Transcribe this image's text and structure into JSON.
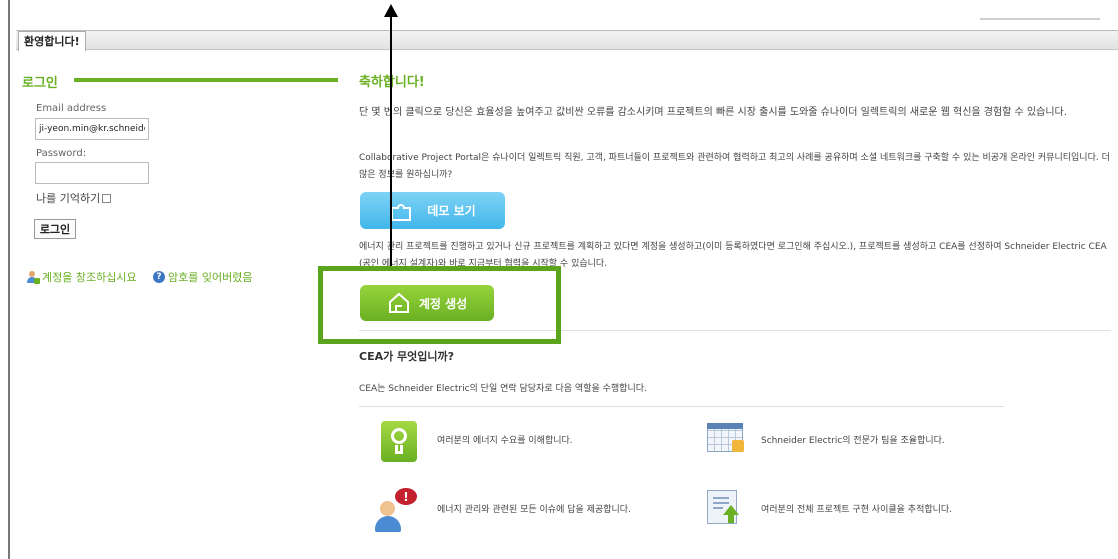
{
  "tab": {
    "label": "환영합니다!"
  },
  "login": {
    "heading": "로그인",
    "email_label": "Email address",
    "email_value": "ji-yeon.min@kr.schneider-",
    "password_label": "Password:",
    "password_value": "",
    "remember_label": "나를 기억하기",
    "login_button": "로그인",
    "create_account_link": "계정을 창조하십시요",
    "forgot_password_link": "암호를 잊어버렸음"
  },
  "main": {
    "title": "축하합니다!",
    "intro": "단 몇 번의 클릭으로 당신은 효율성을 높여주고 값비싼 오류를 감소시키며 프로젝트의 빠른 시장 출시를 도와줄 슈나이더 일렉트릭의 새로운 웹 혁신을 경험할 수 있습니다.",
    "portal_desc": "Collaborative Project Portal은 슈나이더 일렉트릭 직원, 고객, 파트너들이 프로젝트와 관련하여 협력하고 최고의 사례를 공유하며 소셜 네트워크를 구축할 수 있는 비공개 온라인 커뮤니티입니다. 더 많은 정보를 원하십니까?",
    "demo_button": "데모 보기",
    "energy_desc": "에너지 관리 프로젝트를 진행하고 있거나 신규 프로젝트를 계획하고 있다면 계정을 생성하고(이미 등록하였다면 로그인해 주십시오.), 프로젝트를 생성하고 CEA를 선정하여 Schneider Electric CEA (공인 에너지 설계자)와 바로 지금부터 협력을 시작할 수 있습니다.",
    "create_button": "계정 생성",
    "cea_title": "CEA가 무엇입니까?",
    "cea_desc": "CEA는 Schneider Electric의 단일 연락 담당자로 다음 역할을 수행합니다.",
    "roles": [
      {
        "icon": "lightbulb-icon",
        "text": "여러분의 에너지 수요를 이해합니다."
      },
      {
        "icon": "calendar-grid-icon",
        "text": "Schneider Electric의 전문가 팀을 조율합니다."
      },
      {
        "icon": "person-alert-icon",
        "text": "에너지 관리와 관련된 모든 이슈에 답을 제공합니다."
      },
      {
        "icon": "document-upload-icon",
        "text": "여러분의 전체 프로젝트 구현 사이클을 추적합니다."
      }
    ]
  },
  "colors": {
    "accent_green": "#6ab023",
    "demo_blue": "#41b6ea",
    "annotation_black": "#000000"
  }
}
